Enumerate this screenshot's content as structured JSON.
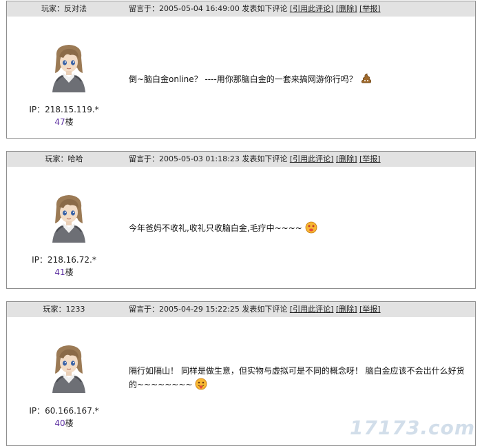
{
  "comments": [
    {
      "player_label": "玩家：反对法",
      "posted_prefix": "留言于：",
      "datetime": "2005-05-04 16:49:00",
      "posted_suffix": "发表如下评论",
      "quote_link": "[引用此评论]",
      "delete_link": "[删除]",
      "report_link": "[举报]",
      "ip": "IP：218.15.119.*",
      "floor_number": "47",
      "floor_suffix": "楼",
      "text": "倒~脑白金online？ ----用你那脑白金的一套来搞网游你行吗？",
      "emoji": "poop-icon"
    },
    {
      "player_label": "玩家：哈哈",
      "posted_prefix": "留言于：",
      "datetime": "2005-05-03 01:18:23",
      "posted_suffix": "发表如下评论",
      "quote_link": "[引用此评论]",
      "delete_link": "[删除]",
      "report_link": "[举报]",
      "ip": "IP：218.16.72.*",
      "floor_number": "41",
      "floor_suffix": "楼",
      "text": "今年爸妈不收礼,收礼只收脑白金,毛疗中~~~~",
      "emoji": "sick-face-icon"
    },
    {
      "player_label": "玩家：1233",
      "posted_prefix": "留言于：",
      "datetime": "2005-04-29 15:22:25",
      "posted_suffix": "发表如下评论",
      "quote_link": "[引用此评论]",
      "delete_link": "[删除]",
      "report_link": "[举报]",
      "ip": "IP：60.166.167.*",
      "floor_number": "40",
      "floor_suffix": "楼",
      "text": "隔行如隔山！ 同样是做生意，但实物与虚拟可是不同的概念呀！ 脑白金应该不会出什么好货的~~~~~~~~",
      "emoji": "tongue-face-icon"
    }
  ],
  "watermark": "17173.com",
  "colors": {
    "header_bg": "#e2e2e2",
    "border": "#8f8f8f",
    "floor_color": "#5b2ea0"
  }
}
